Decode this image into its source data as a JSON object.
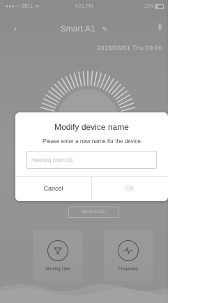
{
  "status_bar": {
    "carrier": "●●●○○ BELL",
    "wifi_icon": "wifi-icon",
    "time": "4:21 PM",
    "battery_text": "22%",
    "battery_icon": "battery-icon"
  },
  "nav": {
    "back_icon": "back-arrow-icon",
    "title": "Smart.A1",
    "edit_icon": "pencil-edit-icon",
    "bluetooth_icon": "bluetooth-icon"
  },
  "datetime": "2019/03/01 Thu  09:00",
  "schedule": {
    "time_range": "08:00-12:00"
  },
  "functions": [
    {
      "label": "Working Time",
      "icon": "funnel-filter-icon"
    },
    {
      "label": "Frequency",
      "icon": "pulse-wave-icon"
    }
  ],
  "dialog": {
    "title": "Modify device name",
    "subtitle": "Please enter a new name for the device",
    "input_placeholder": "meeting room 01",
    "input_value": "",
    "cancel_label": "Cancel",
    "ok_label": "OK"
  },
  "colors": {
    "background": "#a3a3a3",
    "dialog_background": "#ffffff",
    "ok_disabled": "#cccccc",
    "text_primary": "#3c3c3c"
  }
}
